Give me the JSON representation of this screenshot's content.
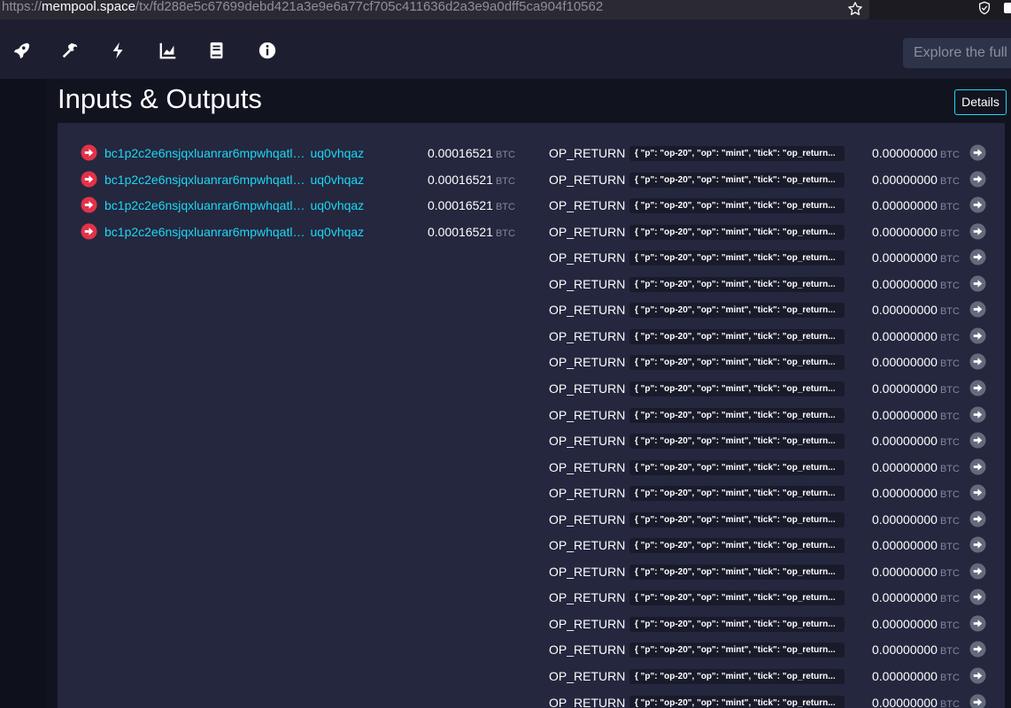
{
  "browser": {
    "url_scheme": "https://",
    "url_host": "mempool.space",
    "url_path": "/tx/fd288e5c67699debd421a3e9e6a77cf705c411636d2a3e9a0dff5ca904f10562"
  },
  "nav": {
    "icons": [
      "rocket-icon",
      "hammer-icon",
      "lightning-icon",
      "chart-icon",
      "book-icon",
      "info-icon"
    ],
    "search_placeholder": "Explore the full Bitcoin ecosystem"
  },
  "main": {
    "title": "Inputs & Outputs",
    "details_label": "Details"
  },
  "inputs": [
    {
      "address": "bc1p2c2e6nsjqxluanrar6mpwhqatl…",
      "address_tail": "uq0vhqaz",
      "amount": "0.00016521",
      "unit": "BTC"
    },
    {
      "address": "bc1p2c2e6nsjqxluanrar6mpwhqatl…",
      "address_tail": "uq0vhqaz",
      "amount": "0.00016521",
      "unit": "BTC"
    },
    {
      "address": "bc1p2c2e6nsjqxluanrar6mpwhqatl…",
      "address_tail": "uq0vhqaz",
      "amount": "0.00016521",
      "unit": "BTC"
    },
    {
      "address": "bc1p2c2e6nsjqxluanrar6mpwhqatl…",
      "address_tail": "uq0vhqaz",
      "amount": "0.00016521",
      "unit": "BTC"
    }
  ],
  "outputs": [
    {
      "label": "OP_RETURN",
      "data": "{ \"p\": \"op-20\", \"op\": \"mint\", \"tick\": \"op_return...",
      "amount": "0.00000000",
      "unit": "BTC"
    },
    {
      "label": "OP_RETURN",
      "data": "{ \"p\": \"op-20\", \"op\": \"mint\", \"tick\": \"op_return...",
      "amount": "0.00000000",
      "unit": "BTC"
    },
    {
      "label": "OP_RETURN",
      "data": "{ \"p\": \"op-20\", \"op\": \"mint\", \"tick\": \"op_return...",
      "amount": "0.00000000",
      "unit": "BTC"
    },
    {
      "label": "OP_RETURN",
      "data": "{ \"p\": \"op-20\", \"op\": \"mint\", \"tick\": \"op_return...",
      "amount": "0.00000000",
      "unit": "BTC"
    },
    {
      "label": "OP_RETURN",
      "data": "{ \"p\": \"op-20\", \"op\": \"mint\", \"tick\": \"op_return...",
      "amount": "0.00000000",
      "unit": "BTC"
    },
    {
      "label": "OP_RETURN",
      "data": "{ \"p\": \"op-20\", \"op\": \"mint\", \"tick\": \"op_return...",
      "amount": "0.00000000",
      "unit": "BTC"
    },
    {
      "label": "OP_RETURN",
      "data": "{ \"p\": \"op-20\", \"op\": \"mint\", \"tick\": \"op_return...",
      "amount": "0.00000000",
      "unit": "BTC"
    },
    {
      "label": "OP_RETURN",
      "data": "{ \"p\": \"op-20\", \"op\": \"mint\", \"tick\": \"op_return...",
      "amount": "0.00000000",
      "unit": "BTC"
    },
    {
      "label": "OP_RETURN",
      "data": "{ \"p\": \"op-20\", \"op\": \"mint\", \"tick\": \"op_return...",
      "amount": "0.00000000",
      "unit": "BTC"
    },
    {
      "label": "OP_RETURN",
      "data": "{ \"p\": \"op-20\", \"op\": \"mint\", \"tick\": \"op_return...",
      "amount": "0.00000000",
      "unit": "BTC"
    },
    {
      "label": "OP_RETURN",
      "data": "{ \"p\": \"op-20\", \"op\": \"mint\", \"tick\": \"op_return...",
      "amount": "0.00000000",
      "unit": "BTC"
    },
    {
      "label": "OP_RETURN",
      "data": "{ \"p\": \"op-20\", \"op\": \"mint\", \"tick\": \"op_return...",
      "amount": "0.00000000",
      "unit": "BTC"
    },
    {
      "label": "OP_RETURN",
      "data": "{ \"p\": \"op-20\", \"op\": \"mint\", \"tick\": \"op_return...",
      "amount": "0.00000000",
      "unit": "BTC"
    },
    {
      "label": "OP_RETURN",
      "data": "{ \"p\": \"op-20\", \"op\": \"mint\", \"tick\": \"op_return...",
      "amount": "0.00000000",
      "unit": "BTC"
    },
    {
      "label": "OP_RETURN",
      "data": "{ \"p\": \"op-20\", \"op\": \"mint\", \"tick\": \"op_return...",
      "amount": "0.00000000",
      "unit": "BTC"
    },
    {
      "label": "OP_RETURN",
      "data": "{ \"p\": \"op-20\", \"op\": \"mint\", \"tick\": \"op_return...",
      "amount": "0.00000000",
      "unit": "BTC"
    },
    {
      "label": "OP_RETURN",
      "data": "{ \"p\": \"op-20\", \"op\": \"mint\", \"tick\": \"op_return...",
      "amount": "0.00000000",
      "unit": "BTC"
    },
    {
      "label": "OP_RETURN",
      "data": "{ \"p\": \"op-20\", \"op\": \"mint\", \"tick\": \"op_return...",
      "amount": "0.00000000",
      "unit": "BTC"
    },
    {
      "label": "OP_RETURN",
      "data": "{ \"p\": \"op-20\", \"op\": \"mint\", \"tick\": \"op_return...",
      "amount": "0.00000000",
      "unit": "BTC"
    },
    {
      "label": "OP_RETURN",
      "data": "{ \"p\": \"op-20\", \"op\": \"mint\", \"tick\": \"op_return...",
      "amount": "0.00000000",
      "unit": "BTC"
    },
    {
      "label": "OP_RETURN",
      "data": "{ \"p\": \"op-20\", \"op\": \"mint\", \"tick\": \"op_return...",
      "amount": "0.00000000",
      "unit": "BTC"
    },
    {
      "label": "OP_RETURN",
      "data": "{ \"p\": \"op-20\", \"op\": \"mint\", \"tick\": \"op_return...",
      "amount": "0.00000000",
      "unit": "BTC"
    }
  ],
  "colors": {
    "accent": "#1bd8f4",
    "input_arrow": "#e2324a",
    "output_arrow": "#636a7c"
  }
}
